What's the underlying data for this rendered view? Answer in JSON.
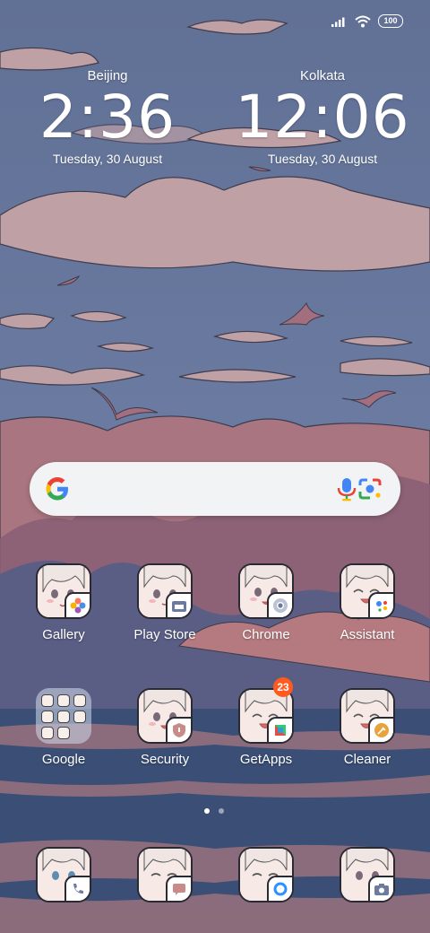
{
  "status_bar": {
    "battery": "100",
    "icons": [
      "signal-icon",
      "wifi-icon",
      "battery-icon"
    ]
  },
  "clocks": [
    {
      "city": "Beijing",
      "time": "2:36",
      "date": "Tuesday, 30 August"
    },
    {
      "city": "Kolkata",
      "time": "12:06",
      "date": "Tuesday, 30 August"
    }
  ],
  "search": {
    "icons": [
      "google-logo-icon",
      "microphone-icon",
      "lens-icon"
    ]
  },
  "apps_row1": [
    {
      "label": "Gallery",
      "badge_icon": "gallery-icon"
    },
    {
      "label": "Play Store",
      "badge_icon": "play-store-icon"
    },
    {
      "label": "Chrome",
      "badge_icon": "chrome-icon"
    },
    {
      "label": "Assistant",
      "badge_icon": "assistant-icon"
    }
  ],
  "apps_row2": [
    {
      "label": "Google",
      "badge_icon": "folder-icon"
    },
    {
      "label": "Security",
      "badge_icon": "security-shield-icon"
    },
    {
      "label": "GetApps",
      "badge_icon": "getapps-icon",
      "notification_count": "23"
    },
    {
      "label": "Cleaner",
      "badge_icon": "broom-icon"
    }
  ],
  "dock": [
    {
      "badge_icon": "phone-icon"
    },
    {
      "badge_icon": "messages-icon"
    },
    {
      "badge_icon": "chat-bubble-icon"
    },
    {
      "badge_icon": "camera-icon"
    }
  ],
  "page_indicator": {
    "pages": 2,
    "current": 1
  },
  "colors": {
    "sky": "#5d6e93",
    "cloud": "#c9a7a8",
    "mountain": "#a87580",
    "water": "#3a4e76"
  }
}
